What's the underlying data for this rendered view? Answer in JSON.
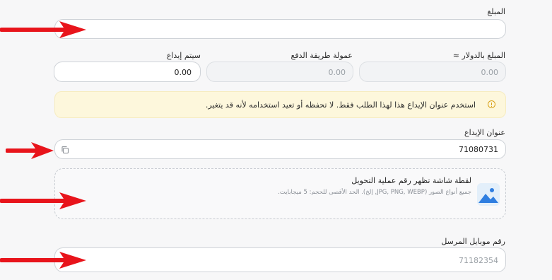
{
  "amount": {
    "label": "المبلغ",
    "value": ""
  },
  "usd_amount": {
    "label": "المبلغ بالدولار ≈",
    "value": "0.00"
  },
  "fee": {
    "label": "عمولة طريقة الدفع",
    "value": "0.00"
  },
  "deposit_total": {
    "label": "سيتم إيداع",
    "value": "0.00"
  },
  "notice": {
    "text": "استخدم عنوان الإيداع هذا لهذا الطلب فقط. لا تحفظه أو تعيد استخدامه لأنه قد يتغير.",
    "color": "#fdf7dc"
  },
  "deposit_address": {
    "label": "عنوان الإيداع",
    "value": "71080731"
  },
  "upload": {
    "title": "لقطة شاشة تظهر رقم عملية التحويل",
    "hint": "جميع أنواع الصور (JPG, PNG, WEBP, إلخ). الحد الأقصى للحجم: 5 ميجابايت."
  },
  "sender_mobile": {
    "label": "رقم موبايل المرسل",
    "placeholder": "71182354"
  },
  "colors": {
    "annotation_arrow": "#e8141b",
    "accent": "#2f7ee0"
  }
}
